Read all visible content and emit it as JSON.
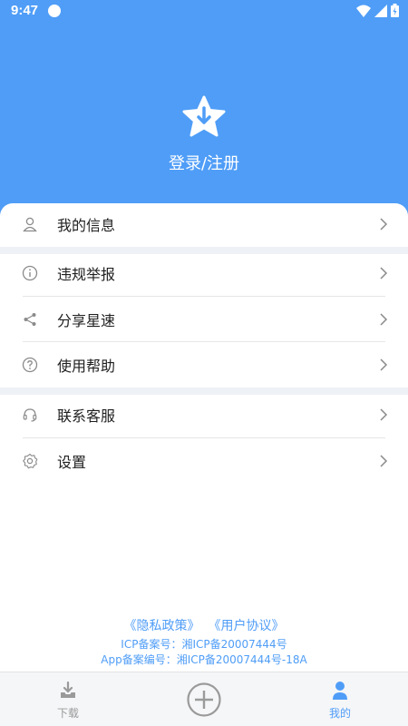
{
  "status_bar": {
    "time": "9:47"
  },
  "header": {
    "login_label": "登录/注册"
  },
  "menu": {
    "items": [
      {
        "label": "我的信息",
        "icon": "user-icon"
      },
      {
        "label": "违规举报",
        "icon": "info-icon"
      },
      {
        "label": "分享星速",
        "icon": "share-icon"
      },
      {
        "label": "使用帮助",
        "icon": "help-icon"
      },
      {
        "label": "联系客服",
        "icon": "headset-icon"
      },
      {
        "label": "设置",
        "icon": "gear-icon"
      }
    ]
  },
  "footer": {
    "privacy_link": "《隐私政策》",
    "agreement_link": "《用户协议》",
    "icp": "ICP备案号：湘ICP备20007444号",
    "app_icp": "App备案编号：湘ICP备20007444号-18A"
  },
  "tabbar": {
    "download_label": "下载",
    "mine_label": "我的",
    "active": "mine"
  },
  "colors": {
    "accent": "#4f9df7",
    "separator": "#eef2f7"
  }
}
